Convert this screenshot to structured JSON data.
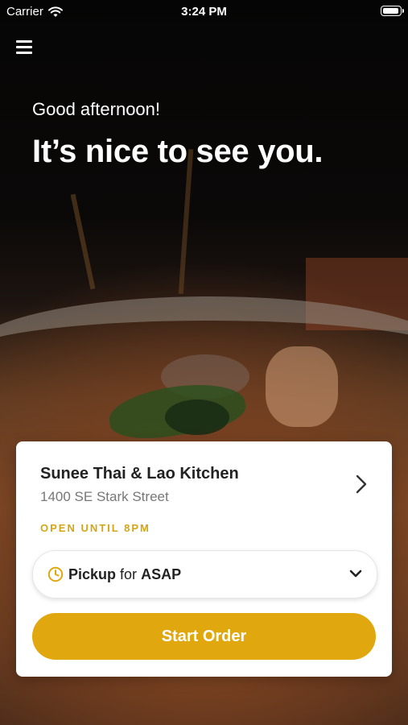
{
  "status_bar": {
    "carrier": "Carrier",
    "time": "3:24 PM",
    "battery_level": 1.0
  },
  "header": {
    "greeting": "Good afternoon!",
    "headline": "It’s nice to see you."
  },
  "store": {
    "name": "Sunee Thai & Lao Kitchen",
    "address": "1400 SE Stark Street",
    "hours": "OPEN UNTIL 8PM"
  },
  "order_mode": {
    "mode": "Pickup",
    "connector": "for",
    "timing": "ASAP"
  },
  "actions": {
    "start_order_label": "Start Order"
  },
  "colors": {
    "accent": "#e0a80e",
    "hours_text": "#d4a514"
  },
  "icons": [
    "wifi-icon",
    "battery-icon",
    "menu-icon",
    "chevron-right-icon",
    "clock-icon",
    "chevron-down-icon"
  ]
}
